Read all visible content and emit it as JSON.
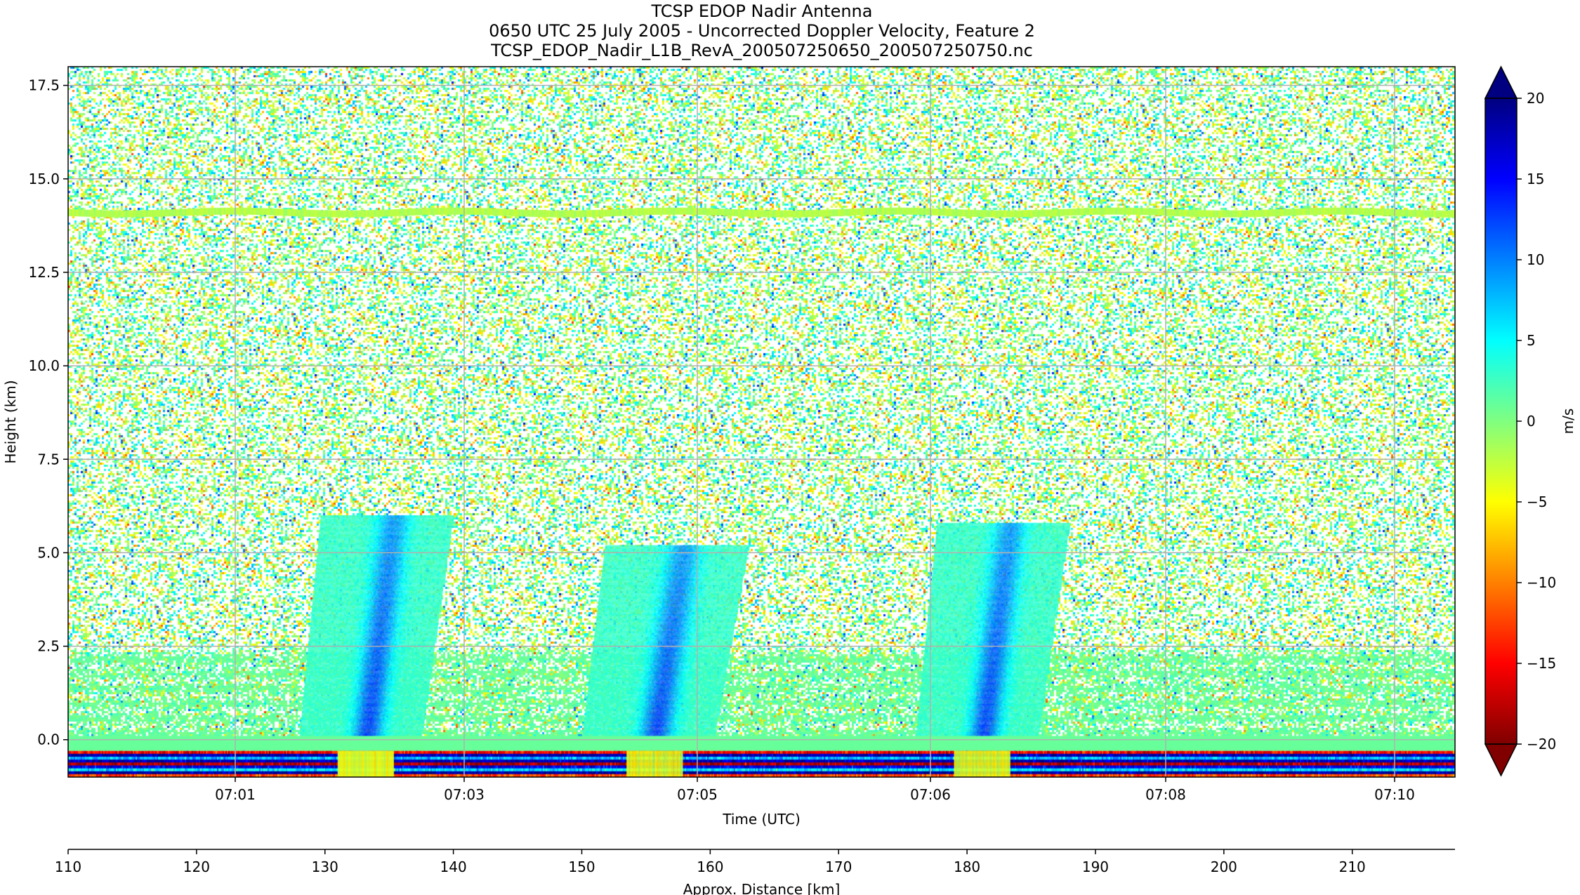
{
  "chart_data": {
    "type": "heatmap",
    "title": "TCSP EDOP Nadir Antenna",
    "subtitle": "0650 UTC 25 July 2005 - Uncorrected Doppler Velocity, Feature 2",
    "filename": "TCSP_EDOP_Nadir_L1B_RevA_200507250650_200507250750.nc",
    "xlabel": "Time (UTC)",
    "ylabel": "Height (km)",
    "x_ticks": [
      "07:01",
      "07:03",
      "07:05",
      "07:06",
      "07:08",
      "07:10"
    ],
    "y_ticks": [
      0.0,
      2.5,
      5.0,
      7.5,
      10.0,
      12.5,
      15.0,
      17.5
    ],
    "ylim": [
      -1.0,
      18.0
    ],
    "grid": true,
    "secondary_axis": {
      "label": "Approx. Distance [km]",
      "ticks": [
        110,
        120,
        130,
        140,
        150,
        160,
        170,
        180,
        190,
        200,
        210
      ],
      "xlim": [
        110,
        218
      ]
    },
    "colorbar": {
      "label": "m/s",
      "ticks": [
        20,
        15,
        10,
        5,
        0,
        -5,
        -10,
        -15,
        -20
      ],
      "range": [
        -20,
        20
      ],
      "colormap": "jet_r",
      "colors": [
        "#800000",
        "#ff0000",
        "#ff8000",
        "#ffff00",
        "#80ff80",
        "#00ffff",
        "#0080ff",
        "#0000ff",
        "#000080"
      ]
    },
    "features": [
      {
        "type": "convective_cell",
        "distance_km": [
          128,
          140
        ],
        "top_km": 6.0,
        "core_velocity_ms": 10
      },
      {
        "type": "convective_cell",
        "distance_km": [
          150,
          163
        ],
        "top_km": 5.2,
        "core_velocity_ms": 10
      },
      {
        "type": "convective_cell",
        "distance_km": [
          176,
          188
        ],
        "top_km": 5.8,
        "core_velocity_ms": 10
      },
      {
        "type": "horizontal_band",
        "height_km": 14.1,
        "velocity_ms": -2
      },
      {
        "type": "surface_return",
        "height_km": [
          -1.0,
          -0.3
        ]
      }
    ]
  }
}
